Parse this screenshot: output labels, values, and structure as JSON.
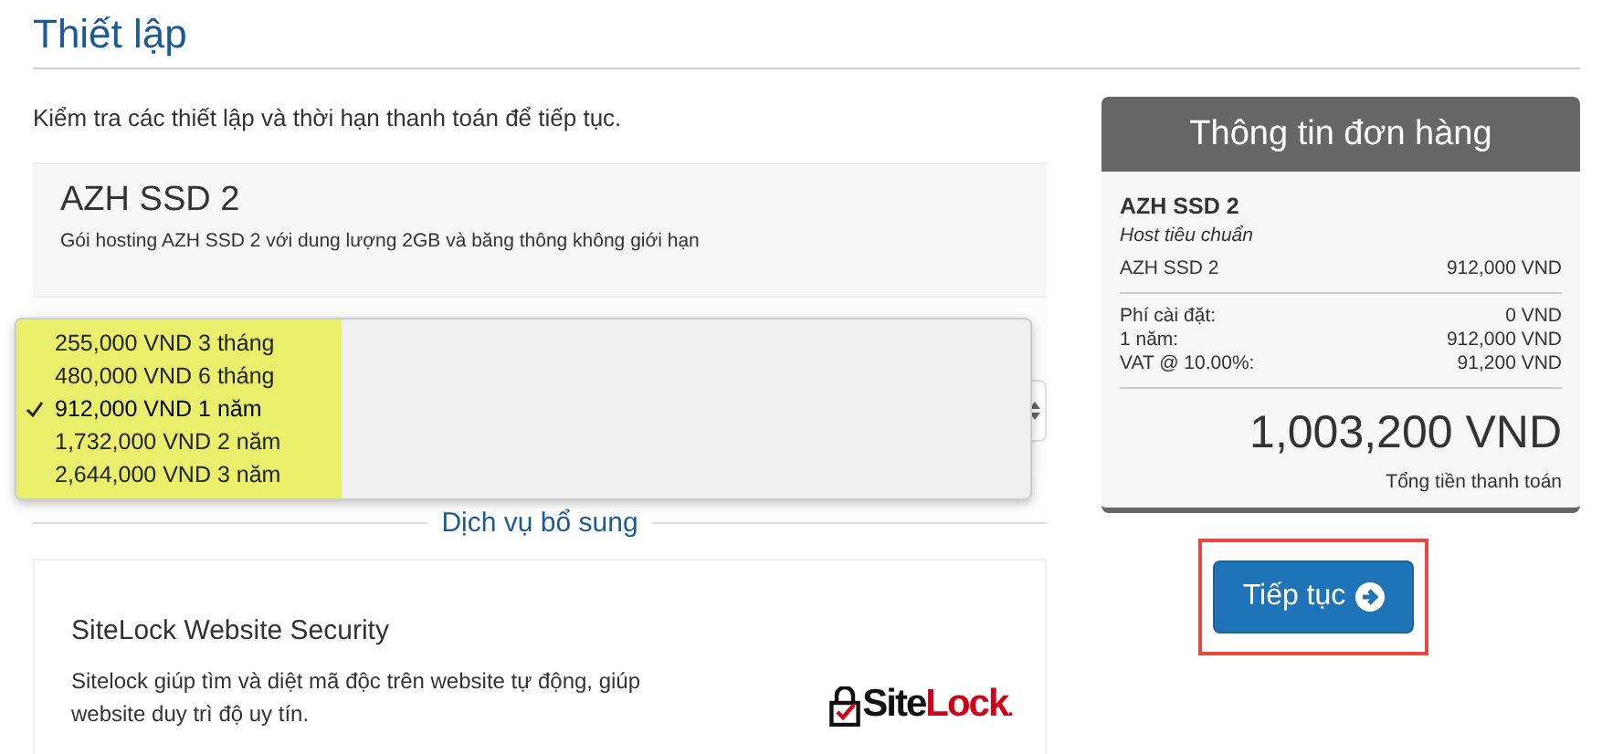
{
  "title": "Thiết lập",
  "intro": "Kiểm tra các thiết lập và thời hạn thanh toán để tiếp tục.",
  "product": {
    "name": "AZH SSD 2",
    "description": "Gói hosting AZH SSD 2 với dung lượng 2GB và băng thông không giới hạn"
  },
  "billing_options": [
    {
      "label": "255,000 VND 3 tháng",
      "selected": false
    },
    {
      "label": "480,000 VND 6 tháng",
      "selected": false
    },
    {
      "label": "912,000 VND 1 năm",
      "selected": true
    },
    {
      "label": "1,732,000 VND 2 năm",
      "selected": false
    },
    {
      "label": "2,644,000 VND 3 năm",
      "selected": false
    }
  ],
  "addons_heading": "Dịch vụ bổ sung",
  "addon": {
    "name": "SiteLock Website Security",
    "description": "Sitelock giúp tìm và diệt mã độc trên website tự động, giúp website duy trì độ uy tín.",
    "logo_left": "Site",
    "logo_right": "Lock",
    "logo_dot": "."
  },
  "order_summary": {
    "title": "Thông tin đơn hàng",
    "product_name": "AZH SSD 2",
    "product_group": "Host tiêu chuẩn",
    "line": {
      "label": "AZH SSD 2",
      "value": "912,000 VND"
    },
    "fees": [
      {
        "label": "Phí cài đặt:",
        "value": "0 VND"
      },
      {
        "label": "1 năm:",
        "value": "912,000 VND"
      },
      {
        "label": "VAT @ 10.00%:",
        "value": "91,200 VND"
      }
    ],
    "total": "1,003,200 VND",
    "total_label": "Tổng tiền thanh toán"
  },
  "continue_button": "Tiếp tục"
}
